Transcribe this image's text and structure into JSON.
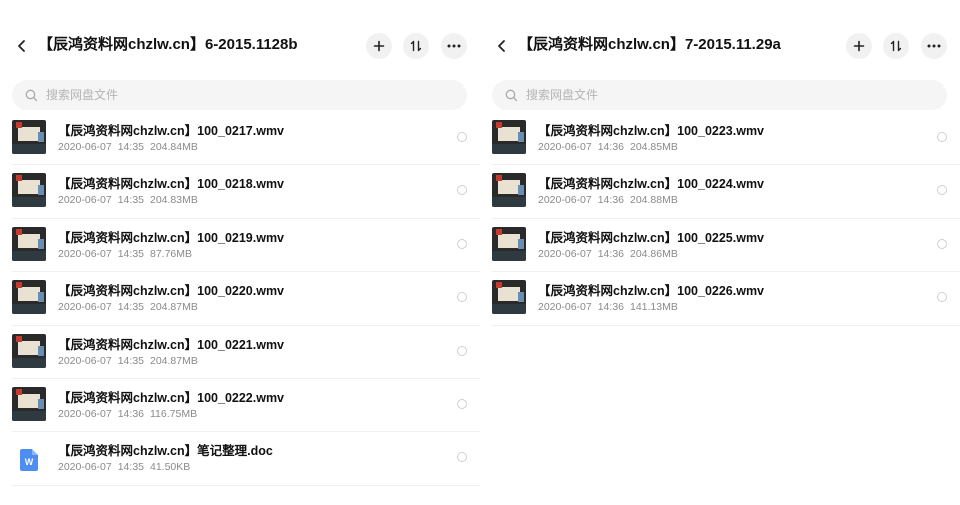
{
  "panels": [
    {
      "title": "【辰鸿资料网chzlw.cn】6-2015.1128b",
      "search_placeholder": "搜索网盘文件",
      "files": [
        {
          "name": "【辰鸿资料网chzlw.cn】100_0217.wmv",
          "date": "2020-06-07",
          "time": "14:35",
          "size": "204.84MB",
          "type": "video"
        },
        {
          "name": "【辰鸿资料网chzlw.cn】100_0218.wmv",
          "date": "2020-06-07",
          "time": "14:35",
          "size": "204.83MB",
          "type": "video"
        },
        {
          "name": "【辰鸿资料网chzlw.cn】100_0219.wmv",
          "date": "2020-06-07",
          "time": "14:35",
          "size": "87.76MB",
          "type": "video"
        },
        {
          "name": "【辰鸿资料网chzlw.cn】100_0220.wmv",
          "date": "2020-06-07",
          "time": "14:35",
          "size": "204.87MB",
          "type": "video"
        },
        {
          "name": "【辰鸿资料网chzlw.cn】100_0221.wmv",
          "date": "2020-06-07",
          "time": "14:35",
          "size": "204.87MB",
          "type": "video"
        },
        {
          "name": "【辰鸿资料网chzlw.cn】100_0222.wmv",
          "date": "2020-06-07",
          "time": "14:36",
          "size": "116.75MB",
          "type": "video"
        },
        {
          "name": "【辰鸿资料网chzlw.cn】笔记整理.doc",
          "date": "2020-06-07",
          "time": "14:35",
          "size": "41.50KB",
          "type": "doc"
        }
      ]
    },
    {
      "title": "【辰鸿资料网chzlw.cn】7-2015.11.29a",
      "search_placeholder": "搜索网盘文件",
      "files": [
        {
          "name": "【辰鸿资料网chzlw.cn】100_0223.wmv",
          "date": "2020-06-07",
          "time": "14:36",
          "size": "204.85MB",
          "type": "video"
        },
        {
          "name": "【辰鸿资料网chzlw.cn】100_0224.wmv",
          "date": "2020-06-07",
          "time": "14:36",
          "size": "204.88MB",
          "type": "video"
        },
        {
          "name": "【辰鸿资料网chzlw.cn】100_0225.wmv",
          "date": "2020-06-07",
          "time": "14:36",
          "size": "204.86MB",
          "type": "video"
        },
        {
          "name": "【辰鸿资料网chzlw.cn】100_0226.wmv",
          "date": "2020-06-07",
          "time": "14:36",
          "size": "141.13MB",
          "type": "video"
        }
      ]
    }
  ],
  "icons": {
    "back": "chevron-left-icon",
    "add": "plus-icon",
    "sort": "sort-arrows-icon",
    "more": "ellipsis-icon",
    "search": "search-icon",
    "doc_letter": "W"
  },
  "colors": {
    "doc_icon": "#4e8ef2",
    "meta_text": "#8a8a8a",
    "search_bg": "#f5f5f5",
    "button_bg": "#f1f1f1"
  }
}
